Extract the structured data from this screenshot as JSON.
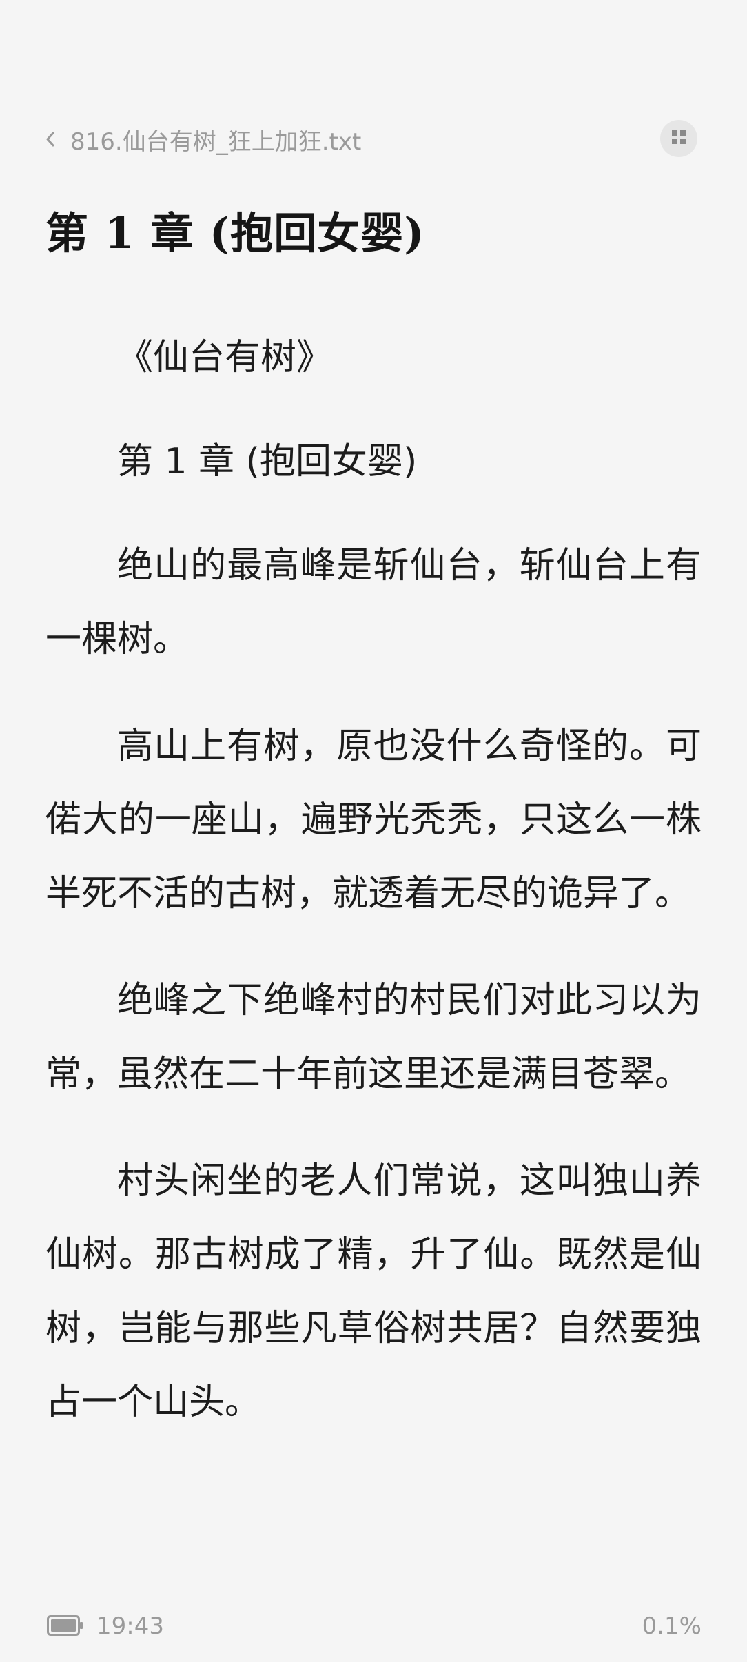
{
  "header": {
    "file_title": "816.仙台有树_狂上加狂.txt",
    "back_icon": "chevron-left-icon",
    "menu_icon": "grid-icon"
  },
  "chapter": {
    "heading": "第 1 章 (抱回女婴)"
  },
  "paragraphs": [
    "《仙台有树》",
    "第 1 章 (抱回女婴)",
    "绝山的最高峰是斩仙台，斩仙台上有一棵树。",
    "高山上有树，原也没什么奇怪的。可偌大的一座山，遍野光秃秃，只这么一株半死不活的古树，就透着无尽的诡异了。",
    "绝峰之下绝峰村的村民们对此习以为常，虽然在二十年前这里还是满目苍翠。",
    "村头闲坐的老人们常说，这叫独山养仙树。那古树成了精，升了仙。既然是仙树，岂能与那些凡草俗树共居？自然要独占一个山头。"
  ],
  "footer": {
    "battery_icon": "battery-icon",
    "time": "19:43",
    "progress": "0.1%"
  },
  "colors": {
    "background": "#f5f5f5",
    "text": "#1c1c1c",
    "muted": "#9a9a9a"
  }
}
